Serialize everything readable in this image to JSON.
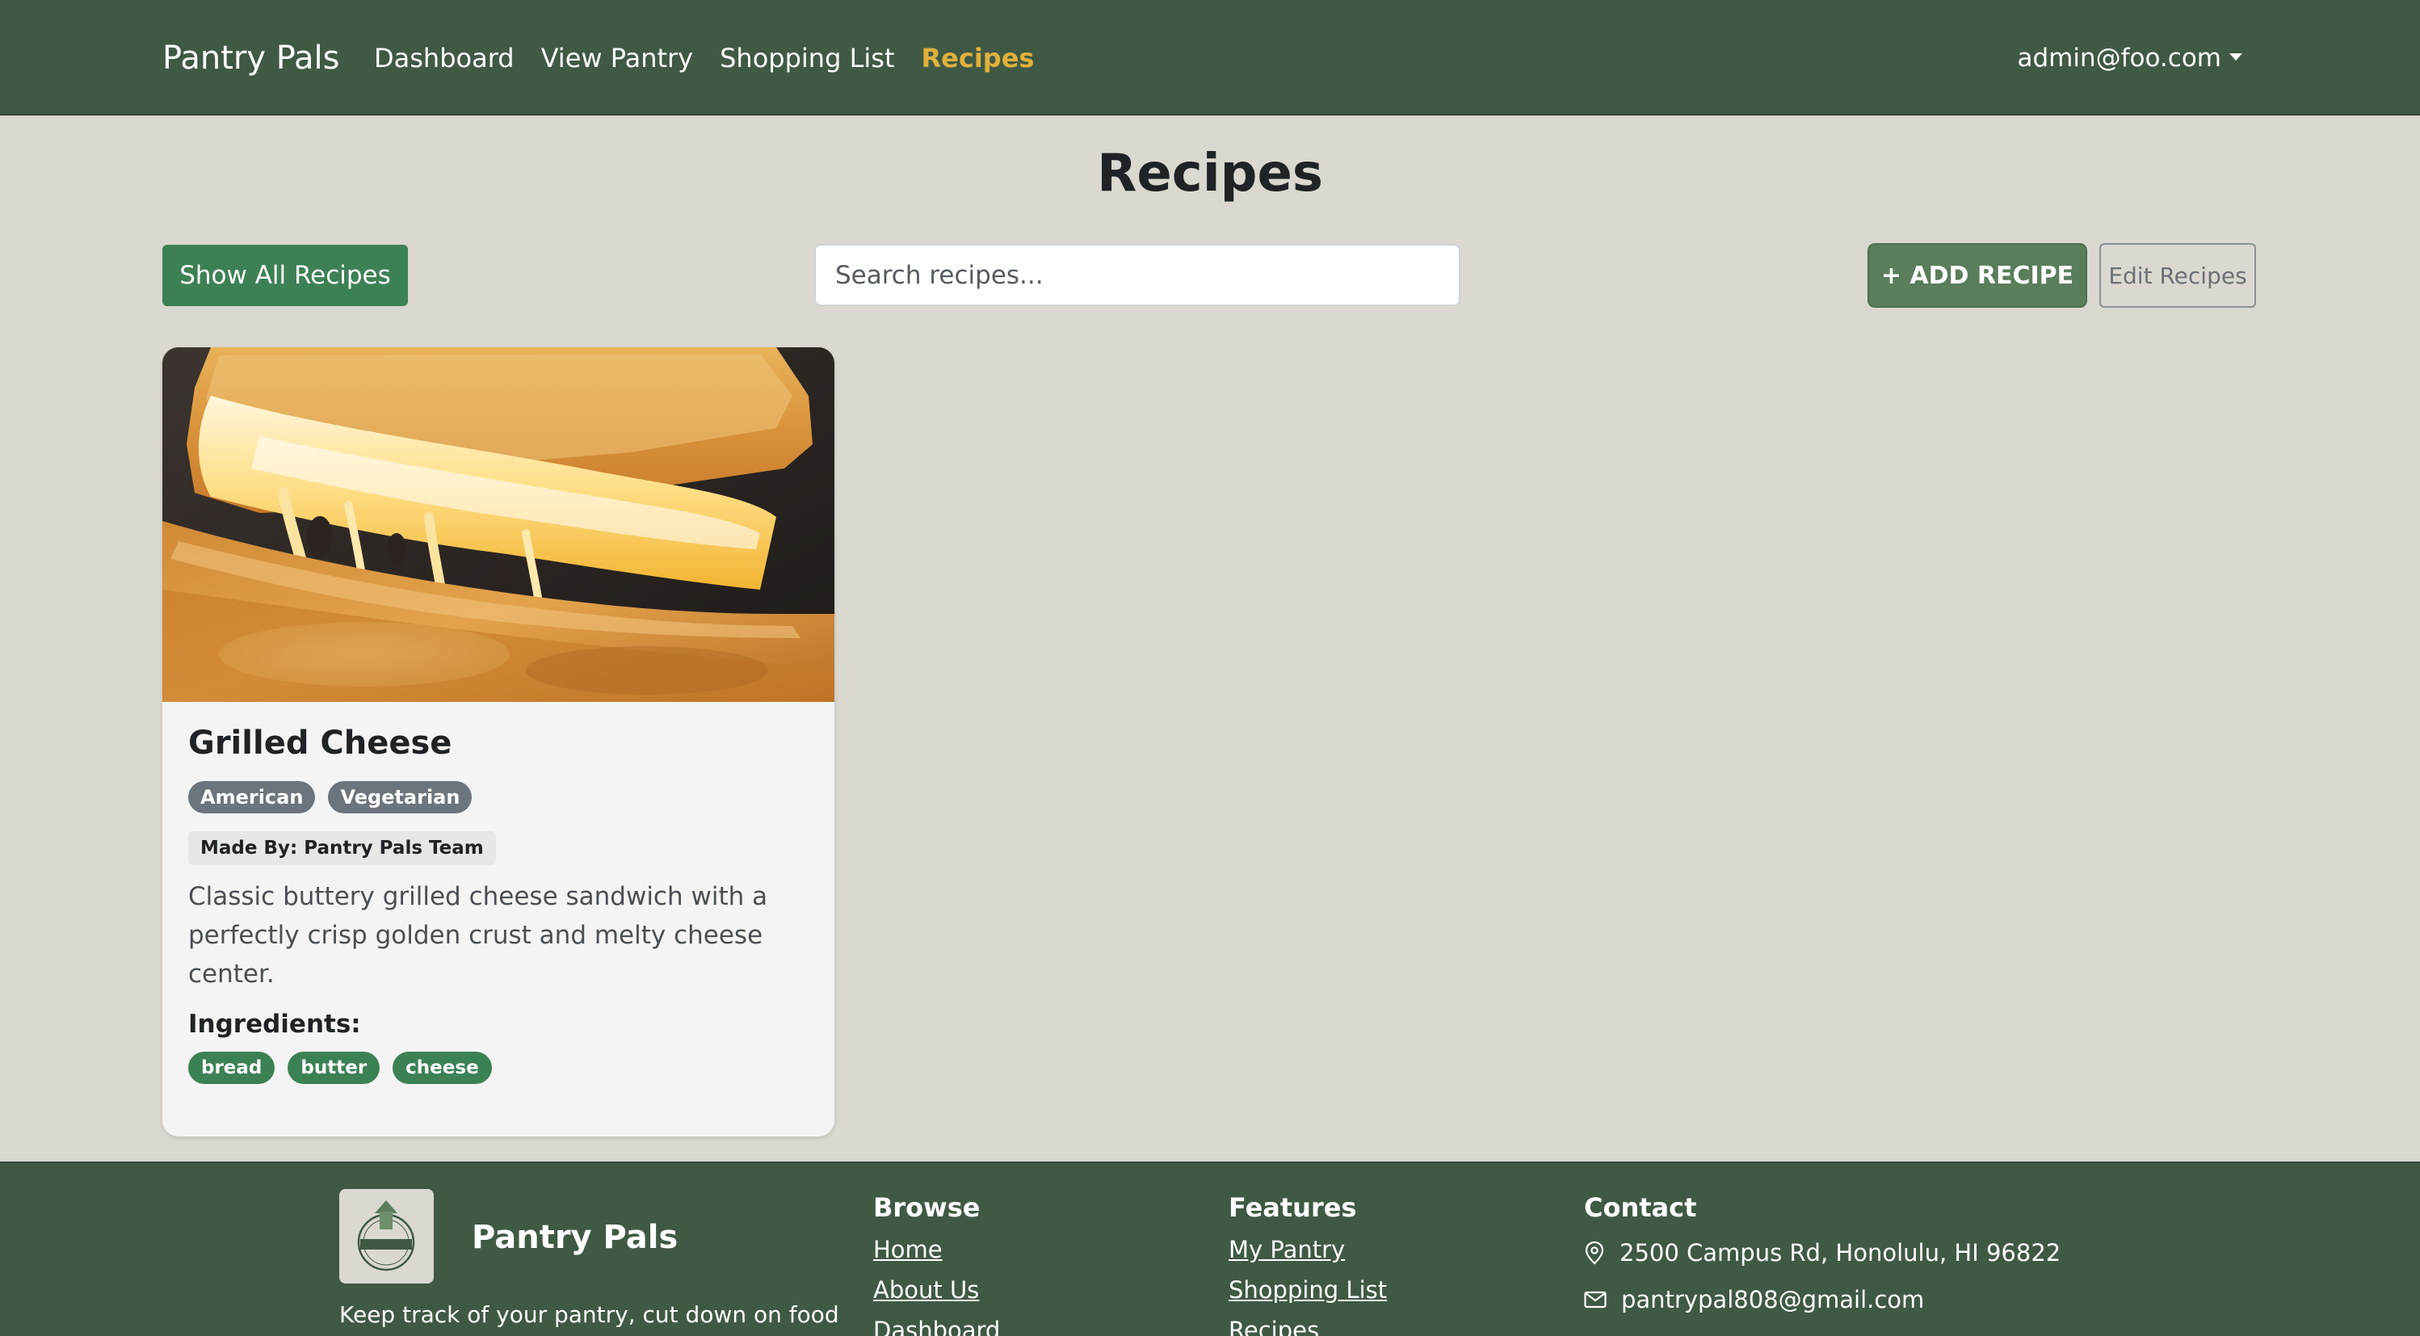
{
  "navbar": {
    "brand": "Pantry Pals",
    "links": [
      {
        "label": "Dashboard",
        "active": false
      },
      {
        "label": "View Pantry",
        "active": false
      },
      {
        "label": "Shopping List",
        "active": false
      },
      {
        "label": "Recipes",
        "active": true
      }
    ],
    "user": "admin@foo.com"
  },
  "page": {
    "title": "Recipes"
  },
  "toolbar": {
    "show_all_label": "Show All Recipes",
    "search_placeholder": "Search recipes...",
    "search_value": "",
    "add_label": "+ ADD RECIPE",
    "edit_label": "Edit Recipes"
  },
  "recipes": [
    {
      "title": "Grilled Cheese",
      "tags": [
        "American",
        "Vegetarian"
      ],
      "author": "Made By: Pantry Pals Team",
      "description": "Classic buttery grilled cheese sandwich with a perfectly crisp golden crust and melty cheese center.",
      "ingredients_label": "Ingredients:",
      "ingredients": [
        "bread",
        "butter",
        "cheese"
      ]
    }
  ],
  "footer": {
    "brand": "Pantry Pals",
    "logo_text": "PANTRY PALS",
    "tagline": "Keep track of your pantry, cut down on food",
    "browse": {
      "heading": "Browse",
      "links": [
        "Home",
        "About Us",
        "Dashboard"
      ]
    },
    "features": {
      "heading": "Features",
      "links": [
        "My Pantry",
        "Shopping List",
        "Recipes"
      ]
    },
    "contact": {
      "heading": "Contact",
      "address": "2500 Campus Rd, Honolulu, HI 96822",
      "email": "pantrypal808@gmail.com"
    }
  },
  "colors": {
    "header_bg": "#405944",
    "page_bg": "#dad8d0",
    "accent_active": "#e0b13c",
    "primary_green": "#3c8155",
    "add_button": "#5a7d5c",
    "tag_gray": "#6c757d"
  }
}
